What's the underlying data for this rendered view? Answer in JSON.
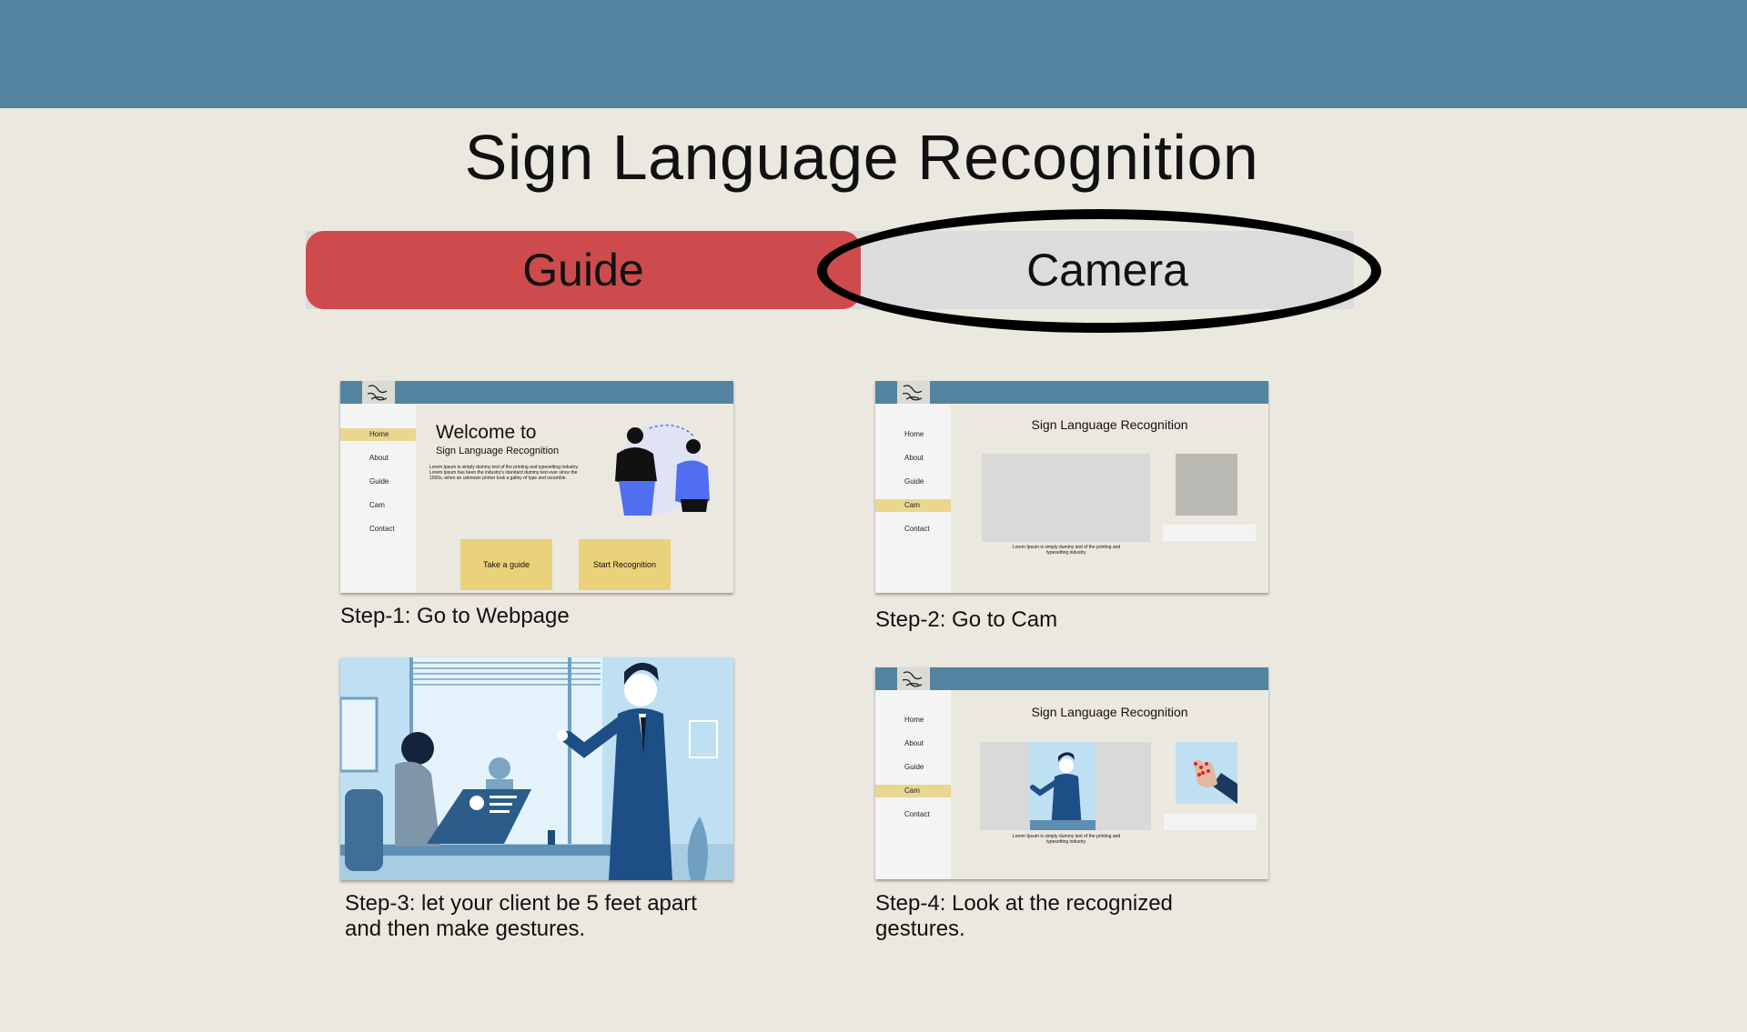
{
  "page": {
    "title": "Sign Language Recognition"
  },
  "tabs": {
    "guide": "Guide",
    "camera": "Camera"
  },
  "colors": {
    "header": "#52849f",
    "background": "#ebe8e0",
    "guide_tab": "#cd4b4d",
    "camera_tab": "#dcdcdc",
    "active_nav": "#e9d68f"
  },
  "step1": {
    "caption": "Step-1: Go to Webpage",
    "nav": [
      "Home",
      "About",
      "Guide",
      "Cam",
      "Contact"
    ],
    "welcome": "Welcome to",
    "subtitle": "Sign Language Recognition",
    "body": "Lorem Ipsum is simply dummy text of the printing and typesetting industry. Lorem Ipsum has been the industry's standard dummy text ever since the 1500s, when an unknown printer took a galley of type and scramble.",
    "btn_guide": "Take a guide",
    "btn_start": "Start Recognition"
  },
  "step2": {
    "caption": "Step-2: Go to Cam",
    "nav": [
      "Home",
      "About",
      "Guide",
      "Cam",
      "Contact"
    ],
    "title": "Sign Language Recognition",
    "lorem": "Lorem Ipsum is simply dummy text of the printing and typesetting industry."
  },
  "step3": {
    "caption_line1": "Step-3: let your client be 5 feet apart",
    "caption_line2": "and then make gestures."
  },
  "step4": {
    "caption_line1": "Step-4: Look at the recognized",
    "caption_line2": "gestures.",
    "nav": [
      "Home",
      "About",
      "Guide",
      "Cam",
      "Contact"
    ],
    "title": "Sign Language Recognition",
    "lorem": "Lorem Ipsum is simply dummy text of the printing and typesetting industry."
  }
}
